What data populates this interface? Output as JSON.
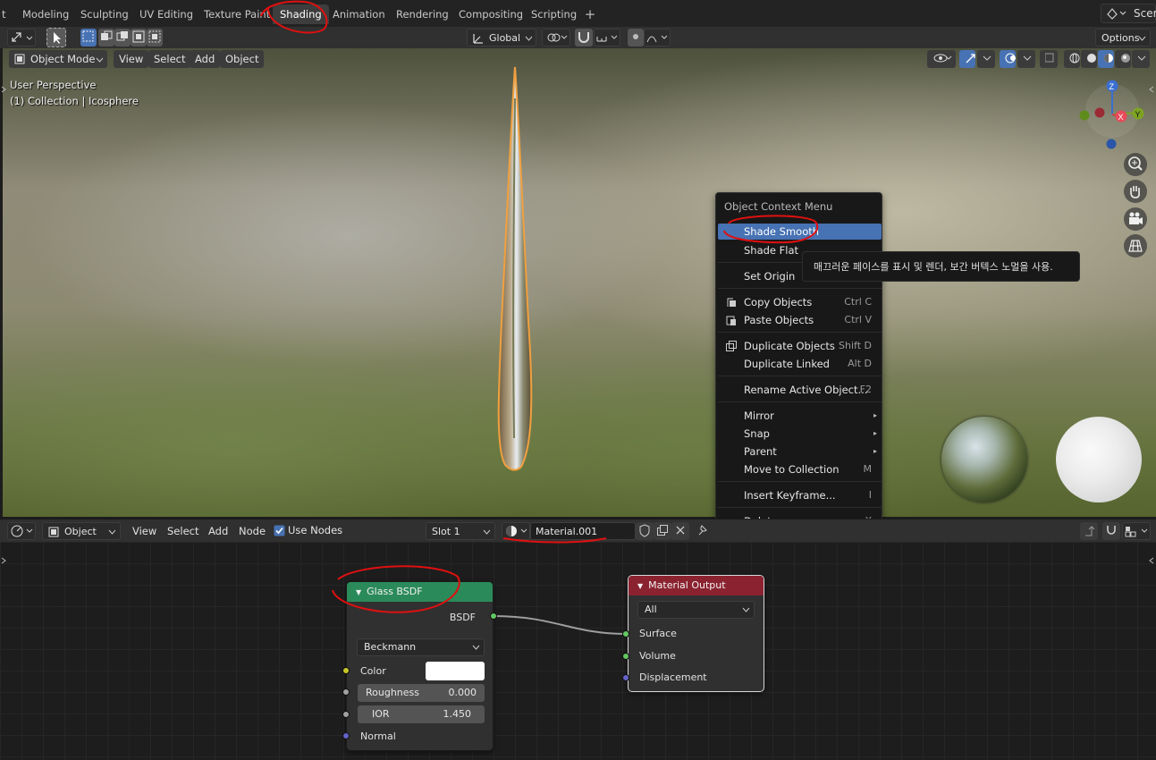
{
  "workspace_tabs": [
    {
      "label": "t"
    },
    {
      "label": "Modeling"
    },
    {
      "label": "Sculpting"
    },
    {
      "label": "UV Editing"
    },
    {
      "label": "Texture Paint"
    },
    {
      "label": "Shading"
    },
    {
      "label": "Animation"
    },
    {
      "label": "Rendering"
    },
    {
      "label": "Compositing"
    },
    {
      "label": "Scripting"
    }
  ],
  "workspace_add_label": "+",
  "scene": {
    "name": "Scer"
  },
  "viewport_header": {
    "transform_orientation": "Global",
    "options_label": "Options"
  },
  "viewport_menu": {
    "mode": "Object Mode",
    "view": "View",
    "select": "Select",
    "add": "Add",
    "object": "Object"
  },
  "viewport_overlay": {
    "perspective": "User Perspective",
    "collection": "(1) Collection | Icosphere"
  },
  "gizmo": {
    "x": "X",
    "y": "Y",
    "z": "Z"
  },
  "context_menu": {
    "title": "Object Context Menu",
    "items": [
      {
        "label": "Shade Smooth",
        "shortcut": ""
      },
      {
        "label": "Shade Flat",
        "shortcut": ""
      },
      {
        "label": "Set Origin",
        "shortcut": ""
      },
      {
        "label": "Copy Objects",
        "shortcut": "Ctrl C"
      },
      {
        "label": "Paste Objects",
        "shortcut": "Ctrl V"
      },
      {
        "label": "Duplicate Objects",
        "shortcut": "Shift D"
      },
      {
        "label": "Duplicate Linked",
        "shortcut": "Alt D"
      },
      {
        "label": "Rename Active Object...",
        "shortcut": "F2"
      },
      {
        "label": "Mirror",
        "shortcut": ""
      },
      {
        "label": "Snap",
        "shortcut": ""
      },
      {
        "label": "Parent",
        "shortcut": ""
      },
      {
        "label": "Move to Collection",
        "shortcut": "M"
      },
      {
        "label": "Insert Keyframe...",
        "shortcut": "I"
      },
      {
        "label": "Delete",
        "shortcut": "X"
      }
    ],
    "submenu_arrow": "▸"
  },
  "tooltip": {
    "text": "매끄러운 페이스를 표시 및 렌더, 보간 버텍스 노멀을 사용."
  },
  "node_editor_header": {
    "object_type": "Object",
    "view": "View",
    "select": "Select",
    "add": "Add",
    "node": "Node",
    "use_nodes_label": "Use Nodes",
    "slot": "Slot 1",
    "material_name": "Material.001"
  },
  "glass_node": {
    "title": "Glass BSDF",
    "output_socket": "BSDF",
    "distribution": "Beckmann",
    "color_label": "Color",
    "roughness_label": "Roughness",
    "roughness_value": "0.000",
    "ior_label": "IOR",
    "ior_value": "1.450",
    "normal_label": "Normal",
    "header_color": "#2b8a5a"
  },
  "output_node": {
    "title": "Material Output",
    "target": "All",
    "surface": "Surface",
    "volume": "Volume",
    "displacement": "Displacement",
    "header_color": "#8b2230"
  },
  "colors": {
    "accent_blue": "#4772b3",
    "selection_orange": "#f0a040",
    "annotation_red": "#e01010"
  }
}
